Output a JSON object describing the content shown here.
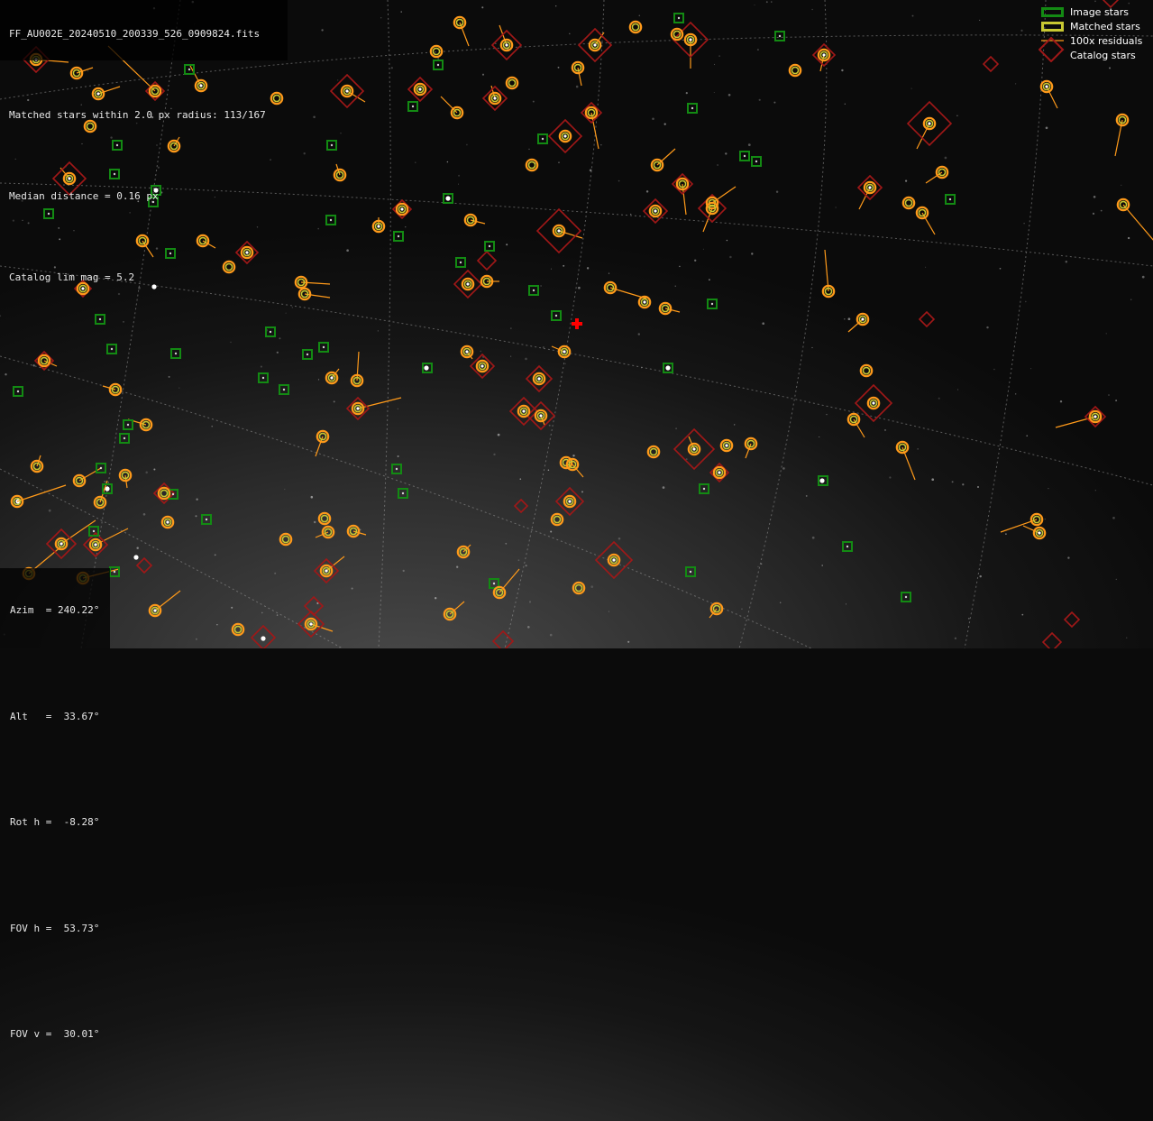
{
  "info": {
    "filename": "FF_AU002E_20240510_200339_526_0909824.fits",
    "matched": "Matched stars within 2.0 px radius: 113/167",
    "median": "Median distance = 0.16 px",
    "catalog": "Catalog lim mag = 5.2"
  },
  "legend": {
    "image_stars": "Image stars",
    "matched_stars": "Matched stars",
    "residuals": "100x residuals",
    "catalog_stars": "Catalog stars"
  },
  "pointing": {
    "azim": "Azim  = 240.22°",
    "alt": "Alt   =  33.67°",
    "rot": "Rot h =  -8.28°",
    "fov_h": "FOV h =  53.73°",
    "fov_v": "FOV v =  30.01°"
  },
  "colors": {
    "image_star": "#138a13",
    "matched_star": "#c8c832",
    "residual": "#ff9a1a",
    "catalog_star": "#a01818",
    "center_marker": "#ff0000",
    "grid": "#9a9a9a"
  }
}
